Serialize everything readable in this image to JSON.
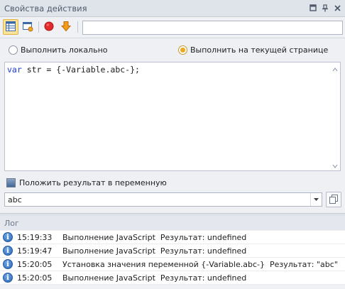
{
  "panel": {
    "title": "Свойства действия",
    "header_icons": [
      "menu-icon",
      "pin-icon",
      "close-icon"
    ]
  },
  "toolbar": {
    "buttons": [
      {
        "name": "properties-view",
        "icon": "table-icon",
        "active": true
      },
      {
        "name": "browser-view",
        "icon": "window-gear-icon",
        "active": false
      },
      {
        "name": "breakpoint",
        "icon": "red-circle-icon",
        "active": false
      },
      {
        "name": "execute",
        "icon": "orange-arrow-down-icon",
        "active": false
      }
    ],
    "input_value": ""
  },
  "execution_mode": {
    "options": [
      {
        "label": "Выполнить локально",
        "checked": false
      },
      {
        "label": "Выполнить на текущей странице",
        "checked": true
      }
    ]
  },
  "editor": {
    "keyword": "var",
    "rest": " str = {-Variable.abc-};"
  },
  "result": {
    "checkbox_label": "Положить результат в переменную",
    "variable_value": "abc"
  },
  "log": {
    "title": "Лог",
    "entries": [
      {
        "time": "15:19:33",
        "message": "Выполнение JavaScript  Результат: undefined"
      },
      {
        "time": "15:19:47",
        "message": "Выполнение JavaScript  Результат: undefined"
      },
      {
        "time": "15:20:05",
        "message": "Установка значения переменной {-Variable.abc-}  Результат: \"abc\""
      },
      {
        "time": "15:20:05",
        "message": "Выполнение JavaScript  Результат: undefined"
      }
    ]
  },
  "colors": {
    "accent_active": "#fbe49a",
    "radio_checked": "#eea81f",
    "keyword": "#1d3cd6",
    "info_icon": "#2a66b5"
  }
}
